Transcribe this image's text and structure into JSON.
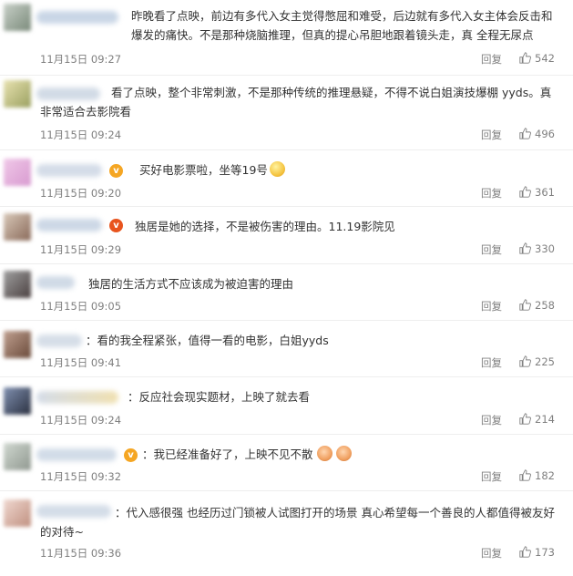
{
  "comments": [
    {
      "text": "昨晚看了点映，前边有多代入女主觉得憋屈和难受，后边就有多代入女主体会反击和爆发的痛快。不是那种烧脑推理，但真的提心吊胆地跟着镜头走，真 全程无尿点",
      "time": "11月15日 09:27",
      "reply": "回复",
      "likes": "542"
    },
    {
      "text": "看了点映，整个非常刺激，不是那种传统的推理悬疑，不得不说白姐演技爆棚 yyds。真非常适合去影院看",
      "time": "11月15日 09:24",
      "reply": "回复",
      "likes": "496"
    },
    {
      "text": "买好电影票啦，坐等19号",
      "time": "11月15日 09:20",
      "reply": "回复",
      "likes": "361"
    },
    {
      "text": "独居是她的选择，不是被伤害的理由。11.19影院见",
      "time": "11月15日 09:29",
      "reply": "回复",
      "likes": "330"
    },
    {
      "text": "独居的生活方式不应该成为被迫害的理由",
      "time": "11月15日 09:05",
      "reply": "回复",
      "likes": "258"
    },
    {
      "text": "看的我全程紧张，值得一看的电影，白姐yyds",
      "time": "11月15日 09:41",
      "reply": "回复",
      "likes": "225"
    },
    {
      "text": "反应社会现实题材，上映了就去看",
      "time": "11月15日 09:24",
      "reply": "回复",
      "likes": "214"
    },
    {
      "text": "我已经准备好了，上映不见不散",
      "time": "11月15日 09:32",
      "reply": "回复",
      "likes": "182"
    },
    {
      "text": "代入感很强 也经历过门锁被人试图打开的场景 真心希望每一个善良的人都值得被友好的对待~",
      "time": "11月15日 09:36",
      "reply": "回复",
      "likes": "173"
    }
  ],
  "badges": {
    "verified_symbol": "v"
  },
  "colors": {
    "badge_gold": "#f5a623",
    "badge_red": "#e8541e",
    "meta_gray": "#808080"
  },
  "icons": {
    "like": "thumb-up-icon",
    "verified": "verified-badge-icon",
    "emoji": "emoji-icon"
  }
}
